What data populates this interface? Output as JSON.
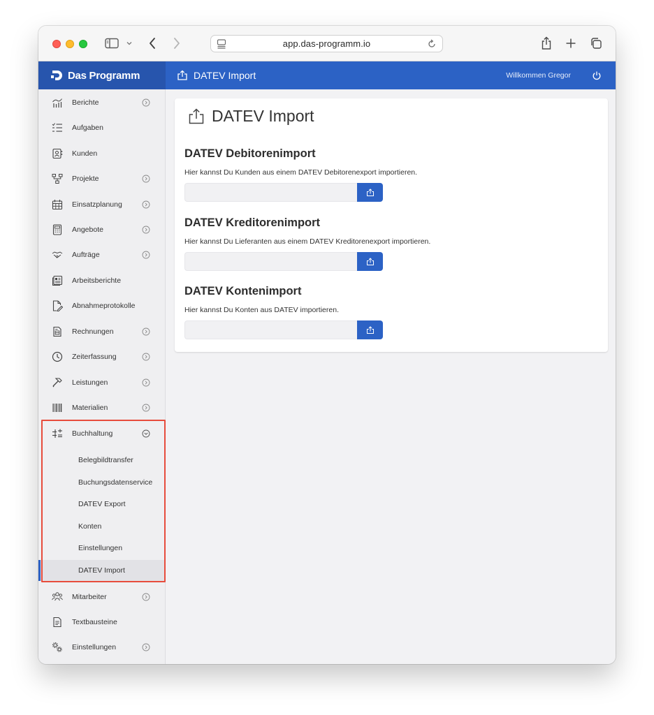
{
  "browser": {
    "url": "app.das-programm.io"
  },
  "header": {
    "brand": "Das Programm",
    "title": "DATEV Import",
    "welcome": "Willkommen Gregor"
  },
  "sidebar": {
    "items": [
      {
        "label": "Berichte",
        "icon": "chart-icon",
        "chevron": true
      },
      {
        "label": "Aufgaben",
        "icon": "checklist-icon",
        "chevron": false
      },
      {
        "label": "Kunden",
        "icon": "contacts-icon",
        "chevron": false
      },
      {
        "label": "Projekte",
        "icon": "hierarchy-icon",
        "chevron": true
      },
      {
        "label": "Einsatzplanung",
        "icon": "calendar-icon",
        "chevron": true
      },
      {
        "label": "Angebote",
        "icon": "calculator-icon",
        "chevron": true
      },
      {
        "label": "Aufträge",
        "icon": "handshake-icon",
        "chevron": true
      },
      {
        "label": "Arbeitsberichte",
        "icon": "report-icon",
        "chevron": false
      },
      {
        "label": "Abnahmeprotokolle",
        "icon": "document-sign-icon",
        "chevron": false
      },
      {
        "label": "Rechnungen",
        "icon": "invoice-icon",
        "chevron": true
      },
      {
        "label": "Zeiterfassung",
        "icon": "clock-icon",
        "chevron": true
      },
      {
        "label": "Leistungen",
        "icon": "hammer-icon",
        "chevron": true
      },
      {
        "label": "Materialien",
        "icon": "barcode-icon",
        "chevron": true
      },
      {
        "label": "Buchhaltung",
        "icon": "accounting-icon",
        "chevron": true
      }
    ],
    "subitems": [
      {
        "label": "Belegbildtransfer"
      },
      {
        "label": "Buchungsdatenservice"
      },
      {
        "label": "DATEV Export"
      },
      {
        "label": "Konten"
      },
      {
        "label": "Einstellungen"
      },
      {
        "label": "DATEV Import"
      }
    ],
    "bottom_items": [
      {
        "label": "Mitarbeiter",
        "icon": "people-icon",
        "chevron": true
      },
      {
        "label": "Textbausteine",
        "icon": "text-document-icon",
        "chevron": false
      },
      {
        "label": "Einstellungen",
        "icon": "gears-icon",
        "chevron": true
      }
    ]
  },
  "main": {
    "page_title": "DATEV Import",
    "sections": [
      {
        "title": "DATEV Debitorenimport",
        "description": "Hier kannst Du Kunden aus einem DATEV Debitorenexport importieren."
      },
      {
        "title": "DATEV Kreditorenimport",
        "description": "Hier kannst Du Lieferanten aus einem DATEV Kreditorenexport importieren."
      },
      {
        "title": "DATEV Kontenimport",
        "description": "Hier kannst Du Konten aus DATEV importieren."
      }
    ]
  },
  "colors": {
    "accent": "#2c62c5",
    "brand_bg": "#2755ad",
    "highlight": "#e74c3c"
  }
}
